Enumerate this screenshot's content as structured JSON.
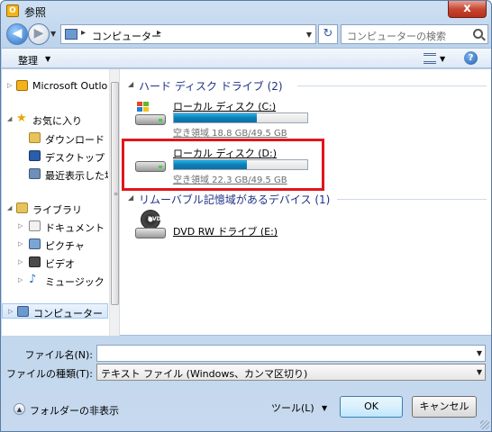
{
  "window": {
    "title": "参照",
    "app_icon_letter": "O",
    "close_glyph": "x"
  },
  "nav": {
    "back_glyph": "◀",
    "address_path": "コンピューター",
    "search_placeholder": "コンピューターの検索",
    "refresh_glyph": "↻"
  },
  "toolbar": {
    "organize": "整理",
    "help_glyph": "?"
  },
  "tree": [
    {
      "label": "Microsoft Outlook",
      "icon": "outlook-icon"
    },
    {
      "label": "お気に入り",
      "icon": "favorites-star-icon"
    },
    {
      "label": "ダウンロード",
      "icon": "downloads-folder-icon"
    },
    {
      "label": "デスクトップ",
      "icon": "desktop-icon"
    },
    {
      "label": "最近表示した場所",
      "icon": "recent-places-icon"
    },
    {
      "label": "ライブラリ",
      "icon": "libraries-icon"
    },
    {
      "label": "ドキュメント",
      "icon": "documents-icon"
    },
    {
      "label": "ピクチャ",
      "icon": "pictures-icon"
    },
    {
      "label": "ビデオ",
      "icon": "videos-icon"
    },
    {
      "label": "ミュージック",
      "icon": "music-icon"
    },
    {
      "label": "コンピューター",
      "icon": "computer-icon",
      "selected": true
    }
  ],
  "groups": {
    "hdd": "ハード ディスク ドライブ (2)",
    "removable": "リムーバブル記憶域があるデバイス (1)"
  },
  "drives": [
    {
      "name": "ローカル ディスク (C:)",
      "free": "空き領域 18.8 GB/49.5 GB",
      "used_fraction": 0.62
    },
    {
      "name": "ローカル ディスク (D:)",
      "free": "空き領域 22.3 GB/49.5 GB",
      "used_fraction": 0.55
    }
  ],
  "dvd": {
    "name": "DVD RW ドライブ (E:)",
    "disc_label": "DVD"
  },
  "form": {
    "filename_label": "ファイル名(N):",
    "filename_value": "",
    "filetype_label": "ファイルの種類(T):",
    "filetype_value": "テキスト ファイル (Windows、カンマ区切り)"
  },
  "footer": {
    "hide_folders": "フォルダーの非表示",
    "tools": "ツール(L)",
    "ok": "OK",
    "cancel": "キャンセル"
  },
  "colors": {
    "accent_group": "#1e3287",
    "drive_fill": "#0d7db7",
    "highlight": "#e0161b"
  }
}
